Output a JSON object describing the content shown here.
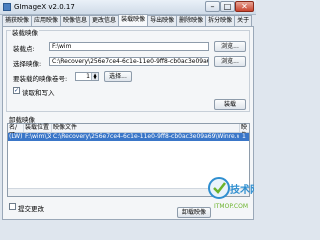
{
  "window": {
    "title": "GImageX v2.0.17"
  },
  "titlebar": {
    "minimize": "–",
    "maximize": "□",
    "close": "✕"
  },
  "tabs": [
    "捕获映像",
    "应用映像",
    "映像信息",
    "更改信息",
    "装载映像",
    "导出映像",
    "删除映像",
    "拆分映像",
    "关于"
  ],
  "active_tab": "装载映像",
  "mount": {
    "group_label": "装载映像",
    "mount_point_label": "装载点:",
    "mount_point_value": "F:\\wim",
    "browse_label": "浏览...",
    "source_label": "选择映像:",
    "source_value": "C:\\Recovery\\256e7ce4-6c1e-11e0-9ff8-cb0ac3e09a69\\Winre.wim",
    "browse2_label": "浏览...",
    "index_label": "要装载的映像卷号:",
    "index_value": "1",
    "select_label": "选择...",
    "rw_checkbox_label": "读取和写入",
    "rw_checked": true,
    "mount_button_label": "装载"
  },
  "mounted": {
    "group_label": "卸载映像",
    "columns": [
      "名/可",
      "装载位置",
      "映像文件",
      "映像"
    ],
    "rows": [
      {
        "name": "(LW)",
        "location": "F:\\wim\\文件名",
        "file": "C:\\Recovery\\256e7ce4-6c1e-11e0-9ff8-cb0ac3e09a69\\Winre.wim",
        "index": "1"
      }
    ],
    "commit_checkbox_label": "提交更改",
    "commit_checked": false,
    "unmount_button_label": "卸载映像"
  },
  "watermark": {
    "text": "技术网",
    "domain": "ITMOP.COM",
    "accent": "#2f8fd0",
    "accent2": "#6bb32c"
  }
}
